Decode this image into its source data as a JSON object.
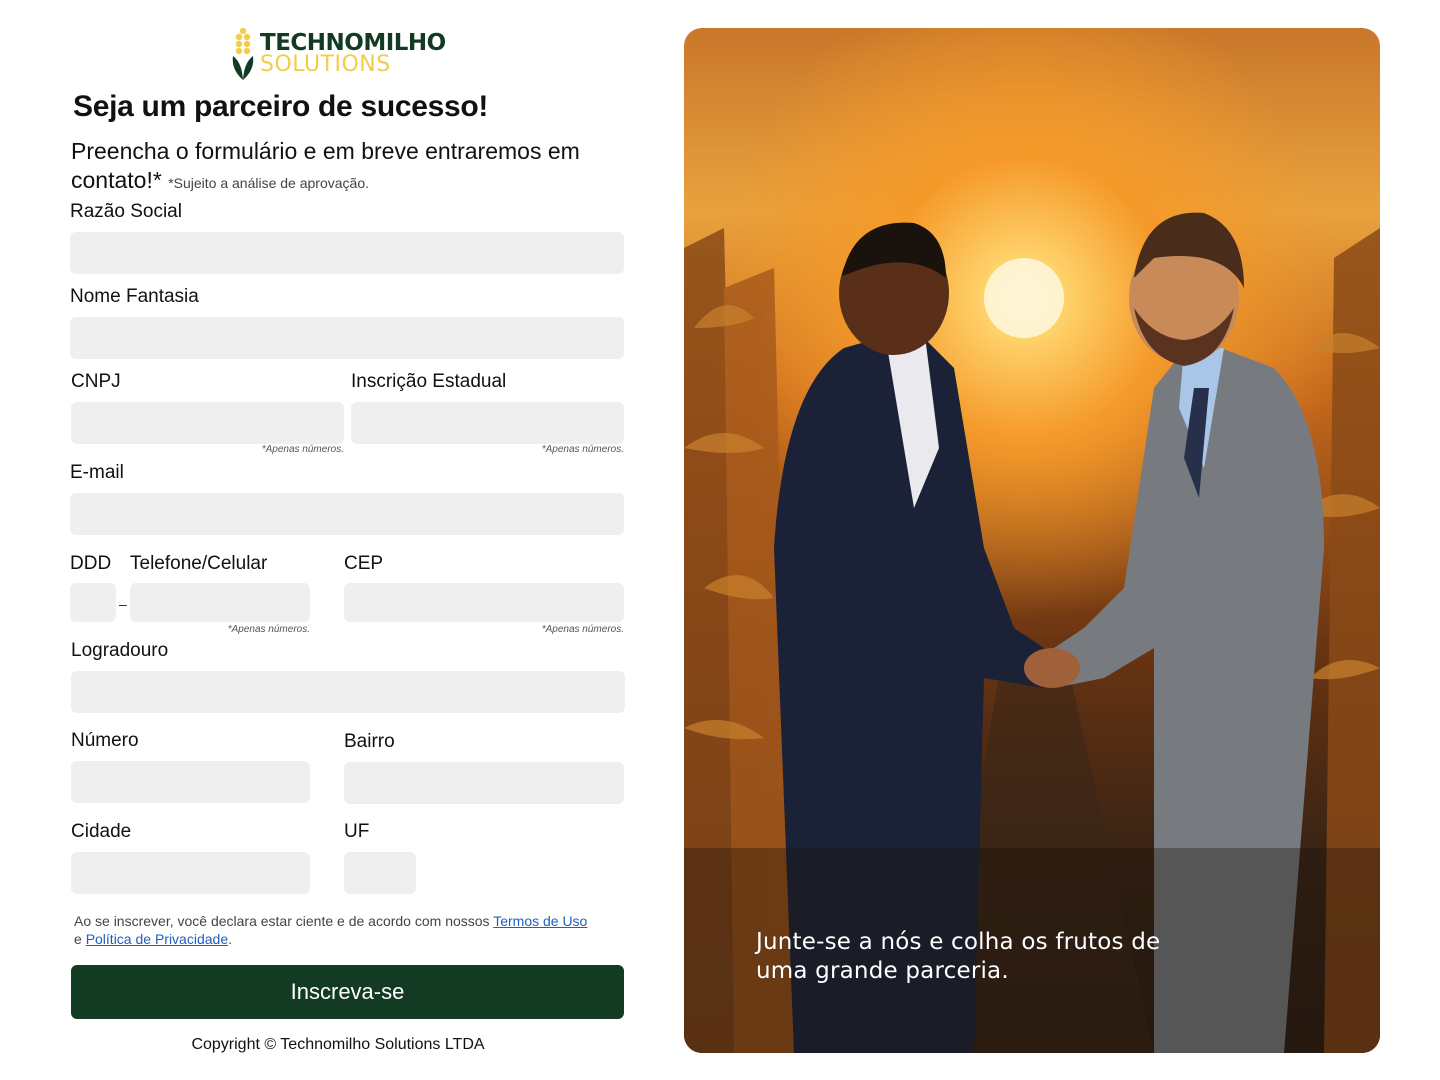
{
  "brand": {
    "name_line1": "TECHNOMILHO",
    "name_line2": "SOLUTIONS",
    "primary_color": "#133a22",
    "accent_color": "#f2cc4a"
  },
  "page": {
    "title": "Seja um parceiro de sucesso!",
    "intro": "Preencha o formulário e em breve entraremos em contato!*",
    "intro_note": "*Sujeito a análise de aprovação."
  },
  "form": {
    "razao_social": {
      "label": "Razão Social",
      "value": ""
    },
    "nome_fantasia": {
      "label": "Nome Fantasia",
      "value": ""
    },
    "cnpj": {
      "label": "CNPJ",
      "value": "",
      "hint": "*Apenas números."
    },
    "inscricao_estadual": {
      "label": "Inscrição Estadual",
      "value": "",
      "hint": "*Apenas números."
    },
    "email": {
      "label": "E-mail",
      "value": ""
    },
    "ddd": {
      "label": "DDD",
      "value": ""
    },
    "phone_separator": "–",
    "telefone": {
      "label": "Telefone/Celular",
      "value": "",
      "hint": "*Apenas números."
    },
    "cep": {
      "label": "CEP",
      "value": "",
      "hint": "*Apenas números."
    },
    "logradouro": {
      "label": "Logradouro",
      "value": ""
    },
    "numero": {
      "label": "Número",
      "value": ""
    },
    "bairro": {
      "label": "Bairro",
      "value": ""
    },
    "cidade": {
      "label": "Cidade",
      "value": ""
    },
    "uf": {
      "label": "UF",
      "value": ""
    }
  },
  "terms": {
    "prefix": "Ao se inscrever, você declara estar ciente e de acordo com nossos",
    "terms_link": "Termos de Uso",
    "connector": "e",
    "privacy_link": "Política de Privacidade",
    "suffix": "."
  },
  "submit_label": "Inscreva-se",
  "copyright": "Copyright © Technomilho Solutions LTDA",
  "hero": {
    "caption": "Junte-se a nós e colha os frutos de uma grande parceria."
  }
}
